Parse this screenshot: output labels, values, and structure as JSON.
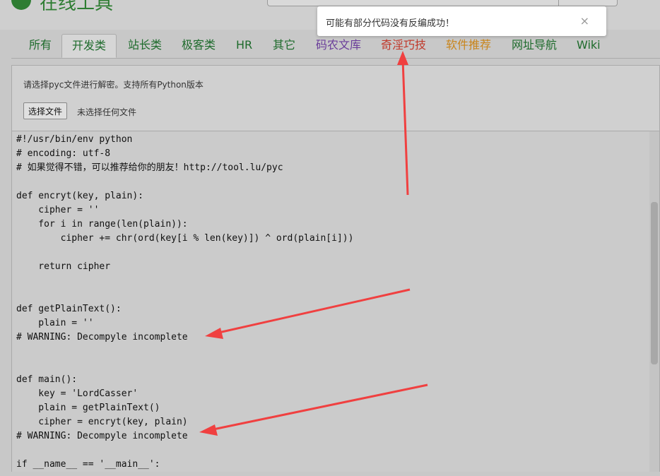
{
  "header": {
    "site_title": "在线工具"
  },
  "tabs": [
    {
      "label": "所有",
      "color": "#1e6b2c"
    },
    {
      "label": "开发类",
      "color": "#1e6b2c"
    },
    {
      "label": "站长类",
      "color": "#1e6b2c"
    },
    {
      "label": "极客类",
      "color": "#1e6b2c"
    },
    {
      "label": "HR",
      "color": "#1e6b2c"
    },
    {
      "label": "其它",
      "color": "#1e6b2c"
    },
    {
      "label": "码农文库",
      "color": "#6a3d9a"
    },
    {
      "label": "奇淫巧技",
      "color": "#c0392b"
    },
    {
      "label": "软件推荐",
      "color": "#c9841a"
    },
    {
      "label": "网址导航",
      "color": "#1e6b2c"
    },
    {
      "label": "Wiki",
      "color": "#1e6b2c"
    }
  ],
  "active_tab": "开发类",
  "upload": {
    "hint": "请选择pyc文件进行解密。支持所有Python版本",
    "button_label": "选择文件",
    "status": "未选择任何文件"
  },
  "code_lines": [
    "#!/usr/bin/env python",
    "# encoding: utf-8",
    "# 如果觉得不错，可以推荐给你的朋友！http://tool.lu/pyc",
    "",
    "def encryt(key, plain):",
    "    cipher = ''",
    "    for i in range(len(plain)):",
    "        cipher += chr(ord(key[i % len(key)]) ^ ord(plain[i]))",
    "",
    "    return cipher",
    "",
    "",
    "def getPlainText():",
    "    plain = ''",
    "# WARNING: Decompyle incomplete",
    "",
    "",
    "def main():",
    "    key = 'LordCasser'",
    "    plain = getPlainText()",
    "    cipher = encryt(key, plain)",
    "# WARNING: Decompyle incomplete",
    "",
    "if __name__ == '__main__':"
  ],
  "toast": {
    "message": "可能有部分代码没有反编成功！",
    "close_symbol": "×"
  },
  "colors": {
    "annotation_arrow": "#f04040"
  }
}
